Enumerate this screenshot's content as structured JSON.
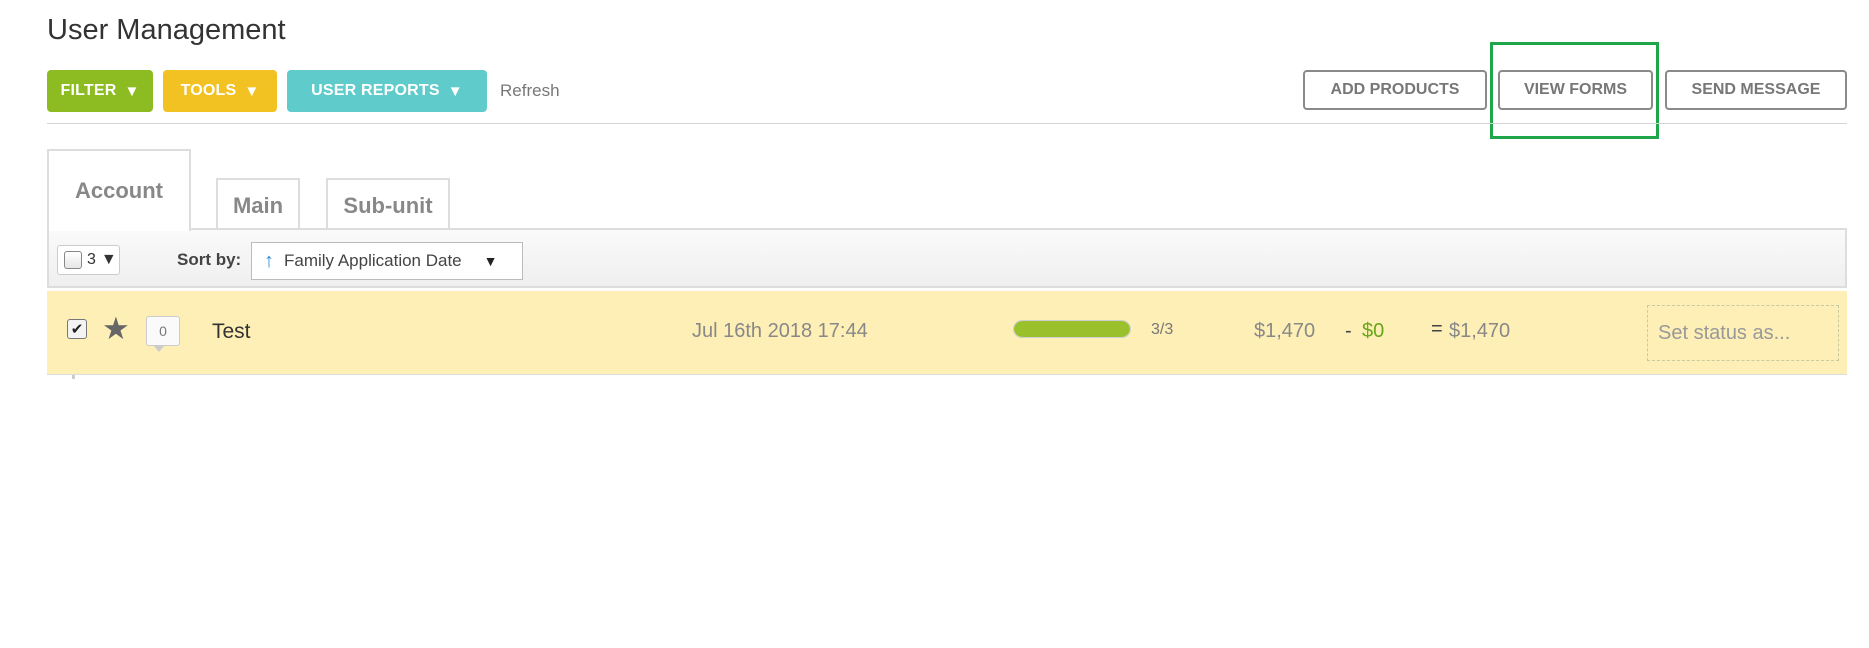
{
  "page": {
    "title": "User Management"
  },
  "toolbar": {
    "filter_label": "FILTER",
    "tools_label": "TOOLS",
    "reports_label": "USER REPORTS",
    "caret": "▼",
    "refresh_label": "Refresh"
  },
  "actions": {
    "add_products": "ADD PRODUCTS",
    "view_forms": "VIEW FORMS",
    "send_message": "SEND MESSAGE"
  },
  "tabs": [
    {
      "label": "Account",
      "active": true
    },
    {
      "label": "Main",
      "active": false
    },
    {
      "label": "Sub-unit",
      "active": false
    }
  ],
  "list_controls": {
    "selected_count": "3",
    "caret": "▼",
    "sort_label": "Sort by:",
    "sort_value": "Family Application Date",
    "sort_direction_icon": "↑"
  },
  "rows": [
    {
      "checked": "✔",
      "comment_count": "0",
      "name": "Test",
      "date": "Jul 16th 2018 17:44",
      "progress_fraction": 1.0,
      "progress_label": "3/3",
      "total": "$1,470",
      "minus": "-",
      "discount": "$0",
      "equals": "=",
      "net": "$1,470",
      "status_placeholder": "Set status as..."
    }
  ],
  "colors": {
    "filter": "#8cbb22",
    "tools": "#f2c223",
    "reports": "#5fcbcb",
    "row_highlight": "#fdefb6",
    "progress": "#9ac12b",
    "highlight_box": "#1fa64a"
  }
}
